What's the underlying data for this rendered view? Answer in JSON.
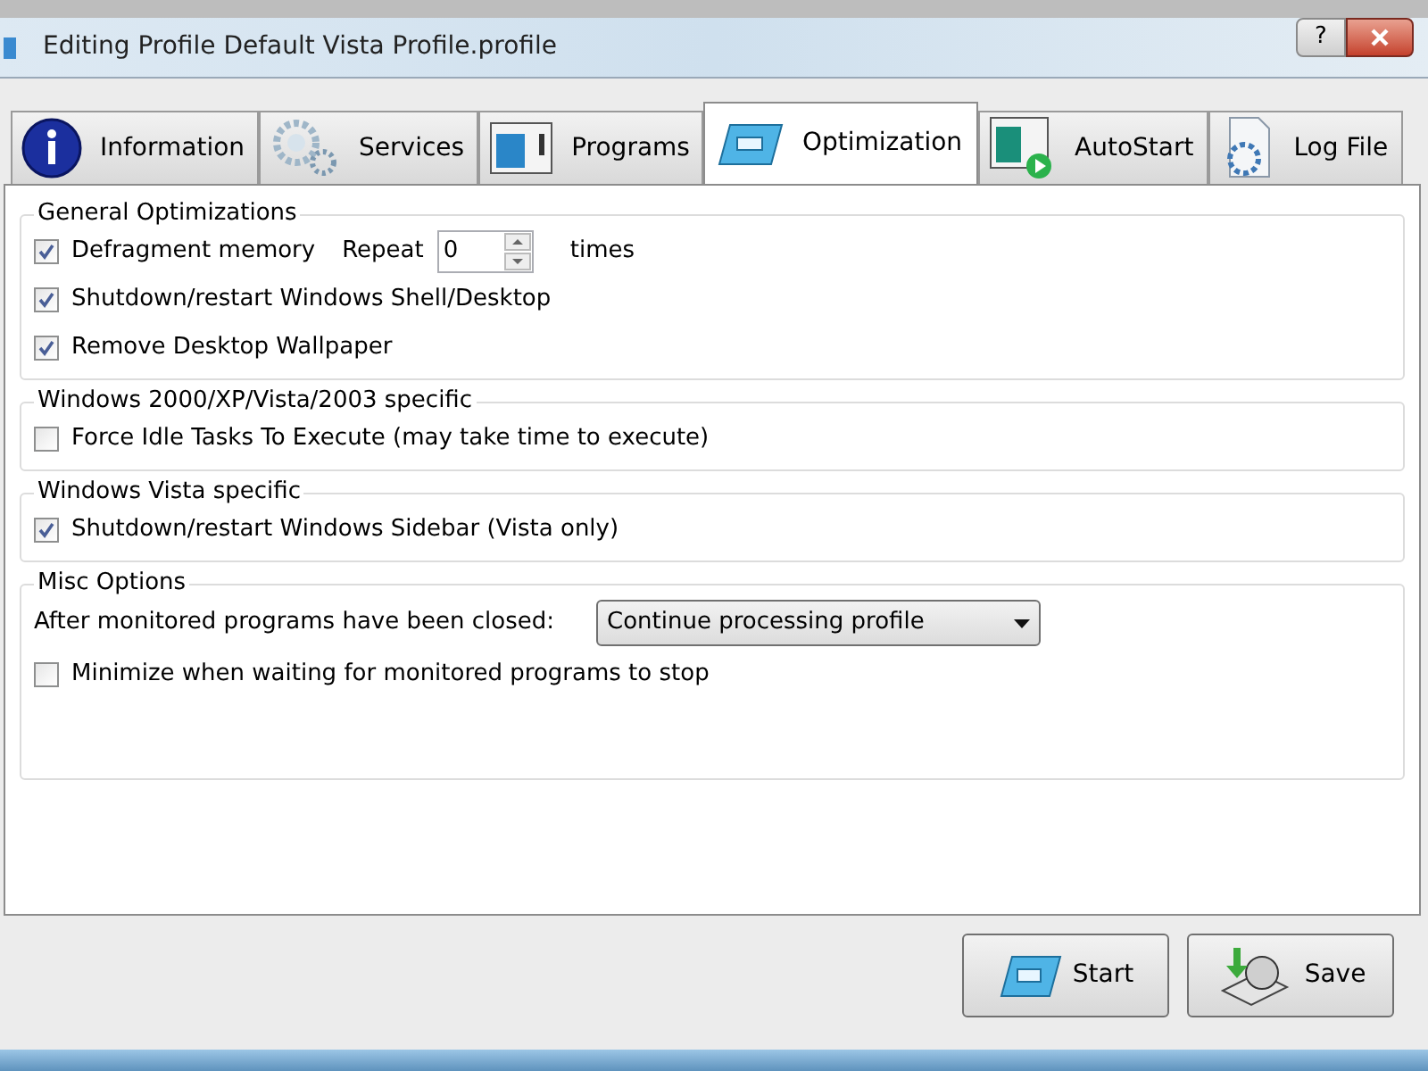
{
  "window": {
    "title": "Editing Profile Default Vista Profile.profile",
    "help": "?"
  },
  "tabs": [
    {
      "label": "Information",
      "selected": false
    },
    {
      "label": "Services",
      "selected": false
    },
    {
      "label": "Programs",
      "selected": false
    },
    {
      "label": "Optimization",
      "selected": true
    },
    {
      "label": "AutoStart",
      "selected": false
    },
    {
      "label": "Log File",
      "selected": false
    }
  ],
  "groups": [
    {
      "title": "General Optimizations",
      "rows": [
        {
          "kind": "checkbox_repeat",
          "label": "Defragment memory",
          "checked": true,
          "repeat_label": "Repeat",
          "value": "0",
          "suffix": "times"
        },
        {
          "kind": "checkbox",
          "label": "Shutdown/restart Windows Shell/Desktop",
          "checked": true
        },
        {
          "kind": "checkbox",
          "label": "Remove Desktop Wallpaper",
          "checked": true
        }
      ]
    },
    {
      "title": "Windows 2000/XP/Vista/2003 specific",
      "rows": [
        {
          "kind": "checkbox",
          "label": "Force Idle Tasks To Execute (may take time to execute)",
          "checked": false
        }
      ]
    },
    {
      "title": "Windows Vista specific",
      "rows": [
        {
          "kind": "checkbox",
          "label": "Shutdown/restart Windows Sidebar (Vista only)",
          "checked": true
        }
      ]
    },
    {
      "title": "Misc Options",
      "rows": [
        {
          "kind": "dropdown",
          "label": "After monitored programs have been closed:",
          "value": "Continue processing profile"
        },
        {
          "kind": "checkbox",
          "label": "Minimize when waiting for monitored programs to stop",
          "checked": false
        }
      ]
    }
  ],
  "buttons": [
    "Start",
    "Save"
  ]
}
